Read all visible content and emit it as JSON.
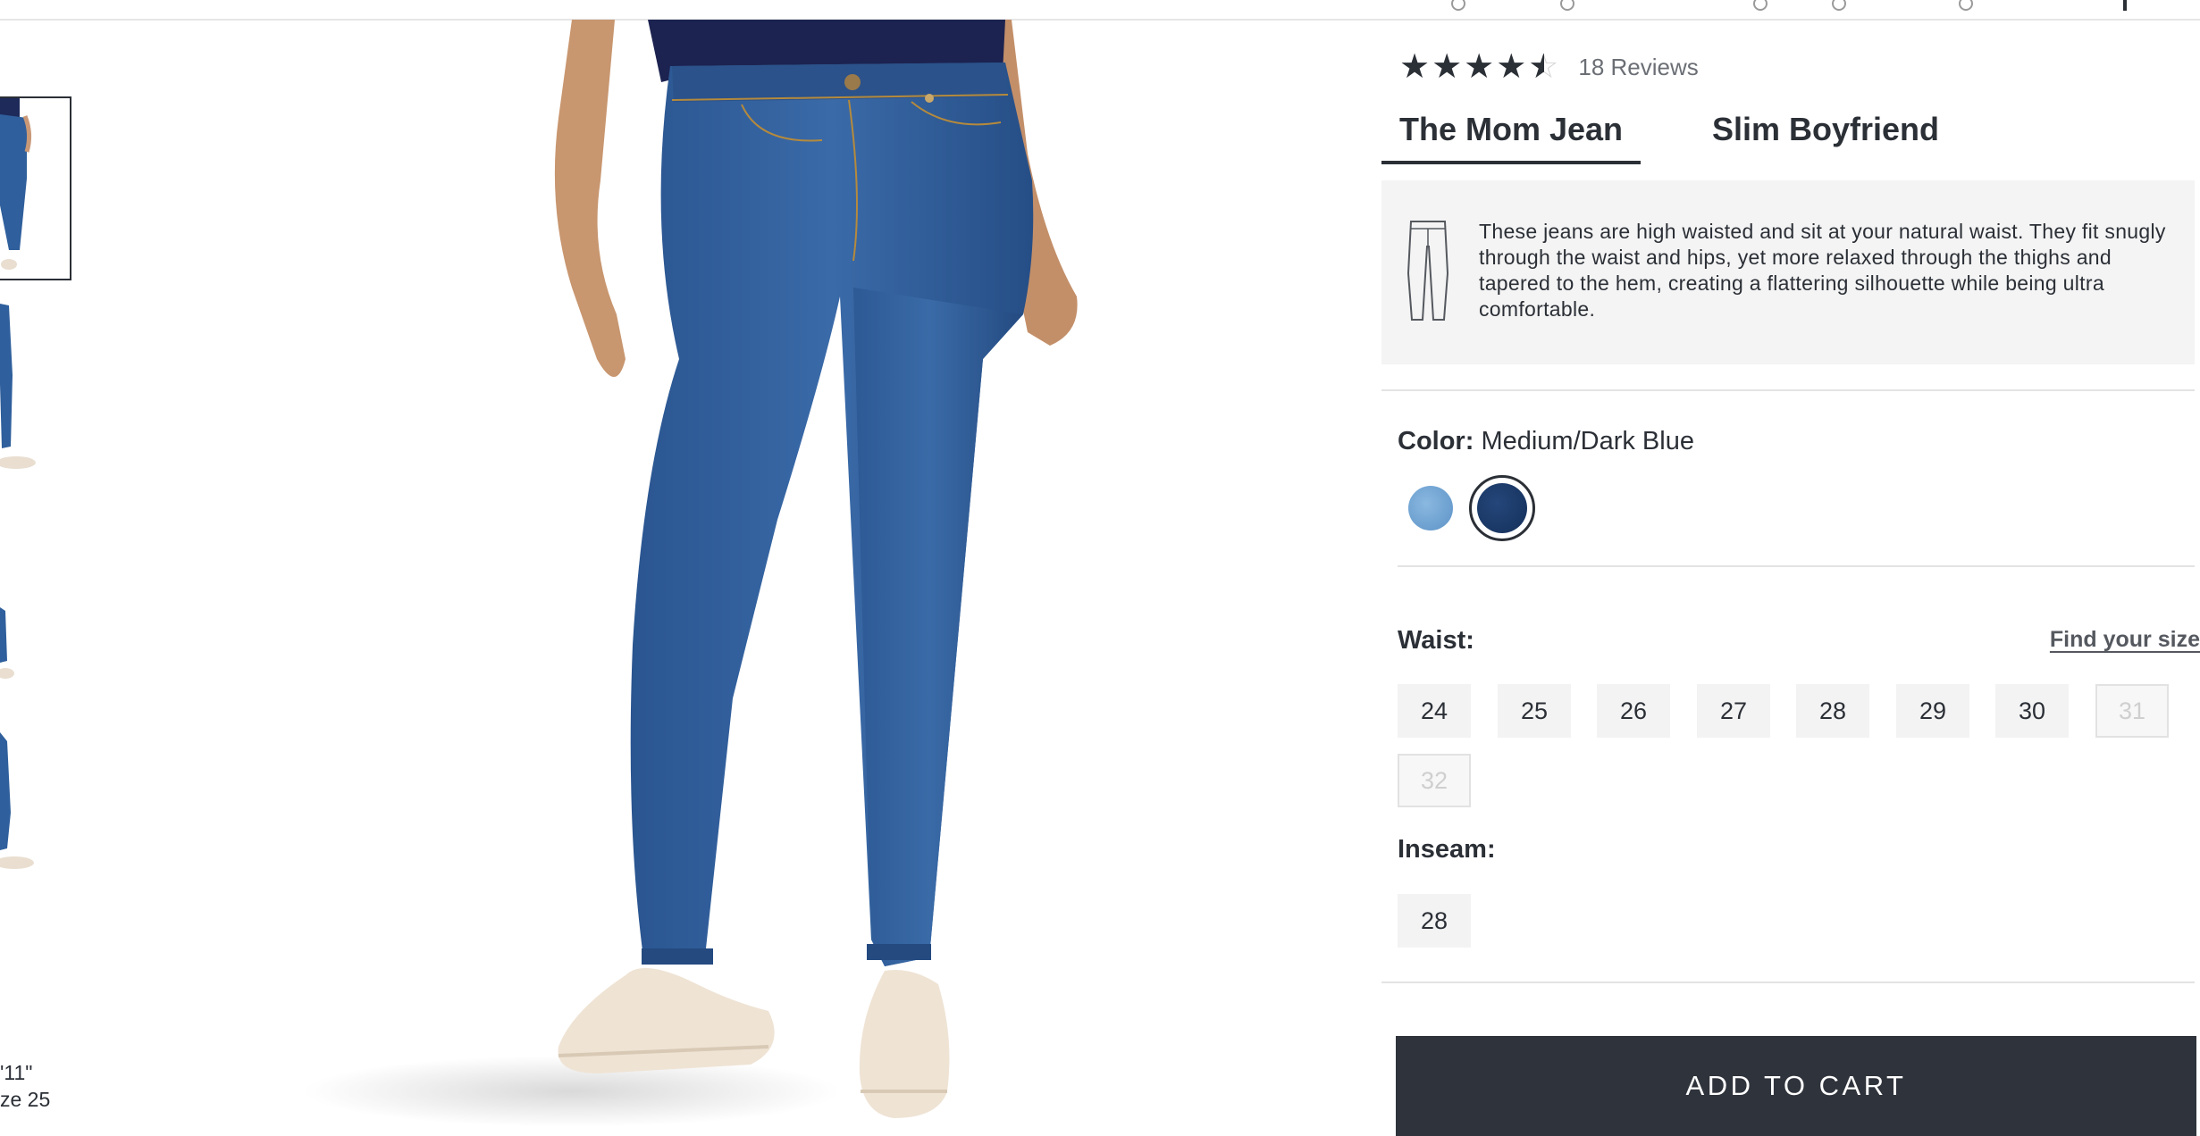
{
  "product": {
    "rating_value": 4.5,
    "rating_max": 5,
    "reviews_label": "18 Reviews"
  },
  "fit_tabs": [
    {
      "label": "The Mom Jean",
      "active": true
    },
    {
      "label": "Slim Boyfriend",
      "active": false
    }
  ],
  "fit_description": "These jeans are high waisted and sit at your natural waist. They fit snugly through the waist and hips, yet more relaxed through the thighs and tapered to the hem, creating a flattering silhouette while being ultra comfortable.",
  "color": {
    "label": "Color:",
    "selected": "Medium/Dark Blue",
    "swatches": [
      {
        "name": "light-wash",
        "hex": "#6fa3d4",
        "selected": false
      },
      {
        "name": "medium-dark-blue",
        "hex": "#1b3a68",
        "selected": true
      }
    ]
  },
  "waist": {
    "label": "Waist:",
    "find_size_link": "Find your size",
    "sizes": [
      {
        "value": "24",
        "available": true
      },
      {
        "value": "25",
        "available": true
      },
      {
        "value": "26",
        "available": true
      },
      {
        "value": "27",
        "available": true
      },
      {
        "value": "28",
        "available": true
      },
      {
        "value": "29",
        "available": true
      },
      {
        "value": "30",
        "available": true
      },
      {
        "value": "31",
        "available": false
      },
      {
        "value": "32",
        "available": false
      }
    ]
  },
  "inseam": {
    "label": "Inseam:",
    "sizes": [
      {
        "value": "28",
        "available": true
      }
    ]
  },
  "add_to_cart_label": "ADD TO CART",
  "model_info_text": "'11\"\nze 25",
  "colors": {
    "accent_dark": "#2f333b",
    "panel_bg": "#f4f4f4",
    "denim": "#2f5f9c"
  }
}
